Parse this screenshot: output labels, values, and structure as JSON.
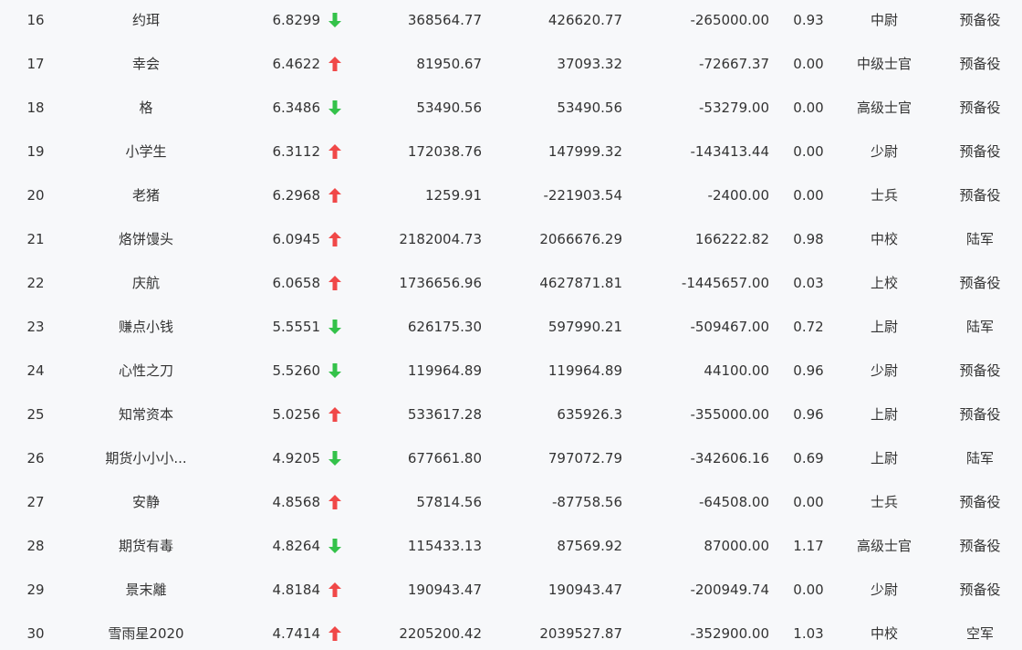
{
  "colors": {
    "background": "#f7f8fa",
    "text": "#333333",
    "up": "#f04848",
    "down": "#34c24a"
  },
  "rows": [
    {
      "rank": "16",
      "name": "约珥",
      "score": "6.8299",
      "trend": "down",
      "trend_icon": "arrow-down-icon",
      "v1": "368564.77",
      "v2": "426620.77",
      "v3": "-265000.00",
      "ratio": "0.93",
      "level": "中尉",
      "type": "预备役"
    },
    {
      "rank": "17",
      "name": "幸会",
      "score": "6.4622",
      "trend": "up",
      "trend_icon": "arrow-up-icon",
      "v1": "81950.67",
      "v2": "37093.32",
      "v3": "-72667.37",
      "ratio": "0.00",
      "level": "中级士官",
      "type": "预备役"
    },
    {
      "rank": "18",
      "name": "格",
      "score": "6.3486",
      "trend": "down",
      "trend_icon": "arrow-down-icon",
      "v1": "53490.56",
      "v2": "53490.56",
      "v3": "-53279.00",
      "ratio": "0.00",
      "level": "高级士官",
      "type": "预备役"
    },
    {
      "rank": "19",
      "name": "小学生",
      "score": "6.3112",
      "trend": "up",
      "trend_icon": "arrow-up-icon",
      "v1": "172038.76",
      "v2": "147999.32",
      "v3": "-143413.44",
      "ratio": "0.00",
      "level": "少尉",
      "type": "预备役"
    },
    {
      "rank": "20",
      "name": "老猪",
      "score": "6.2968",
      "trend": "up",
      "trend_icon": "arrow-up-icon",
      "v1": "1259.91",
      "v2": "-221903.54",
      "v3": "-2400.00",
      "ratio": "0.00",
      "level": "士兵",
      "type": "预备役"
    },
    {
      "rank": "21",
      "name": "烙饼馒头",
      "score": "6.0945",
      "trend": "up",
      "trend_icon": "arrow-up-icon",
      "v1": "2182004.73",
      "v2": "2066676.29",
      "v3": "166222.82",
      "ratio": "0.98",
      "level": "中校",
      "type": "陆军"
    },
    {
      "rank": "22",
      "name": "庆航",
      "score": "6.0658",
      "trend": "up",
      "trend_icon": "arrow-up-icon",
      "v1": "1736656.96",
      "v2": "4627871.81",
      "v3": "-1445657.00",
      "ratio": "0.03",
      "level": "上校",
      "type": "预备役"
    },
    {
      "rank": "23",
      "name": "赚点小钱",
      "score": "5.5551",
      "trend": "down",
      "trend_icon": "arrow-down-icon",
      "v1": "626175.30",
      "v2": "597990.21",
      "v3": "-509467.00",
      "ratio": "0.72",
      "level": "上尉",
      "type": "陆军"
    },
    {
      "rank": "24",
      "name": "心性之刀",
      "score": "5.5260",
      "trend": "down",
      "trend_icon": "arrow-down-icon",
      "v1": "119964.89",
      "v2": "119964.89",
      "v3": "44100.00",
      "ratio": "0.96",
      "level": "少尉",
      "type": "预备役"
    },
    {
      "rank": "25",
      "name": "知常资本",
      "score": "5.0256",
      "trend": "up",
      "trend_icon": "arrow-up-icon",
      "v1": "533617.28",
      "v2": "635926.3",
      "v3": "-355000.00",
      "ratio": "0.96",
      "level": "上尉",
      "type": "预备役"
    },
    {
      "rank": "26",
      "name": "期货小小小...",
      "score": "4.9205",
      "trend": "down",
      "trend_icon": "arrow-down-icon",
      "v1": "677661.80",
      "v2": "797072.79",
      "v3": "-342606.16",
      "ratio": "0.69",
      "level": "上尉",
      "type": "陆军"
    },
    {
      "rank": "27",
      "name": "安静",
      "score": "4.8568",
      "trend": "up",
      "trend_icon": "arrow-up-icon",
      "v1": "57814.56",
      "v2": "-87758.56",
      "v3": "-64508.00",
      "ratio": "0.00",
      "level": "士兵",
      "type": "预备役"
    },
    {
      "rank": "28",
      "name": "期货有毒",
      "score": "4.8264",
      "trend": "down",
      "trend_icon": "arrow-down-icon",
      "v1": "115433.13",
      "v2": "87569.92",
      "v3": "87000.00",
      "ratio": "1.17",
      "level": "高级士官",
      "type": "预备役"
    },
    {
      "rank": "29",
      "name": "景末離",
      "score": "4.8184",
      "trend": "up",
      "trend_icon": "arrow-up-icon",
      "v1": "190943.47",
      "v2": "190943.47",
      "v3": "-200949.74",
      "ratio": "0.00",
      "level": "少尉",
      "type": "预备役"
    },
    {
      "rank": "30",
      "name": "雪雨星2020",
      "score": "4.7414",
      "trend": "up",
      "trend_icon": "arrow-up-icon",
      "v1": "2205200.42",
      "v2": "2039527.87",
      "v3": "-352900.00",
      "ratio": "1.03",
      "level": "中校",
      "type": "空军"
    }
  ]
}
